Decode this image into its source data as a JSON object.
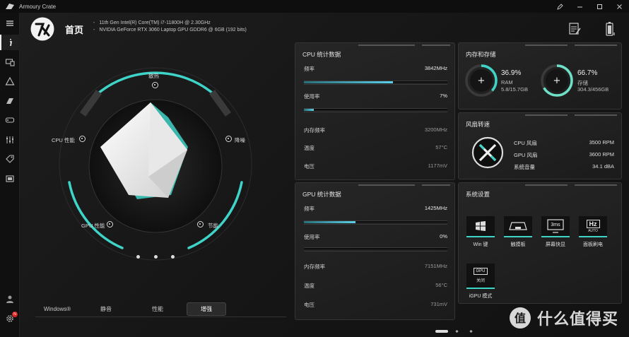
{
  "window": {
    "title": "Armoury Crate",
    "controls": [
      "minimize",
      "maximize",
      "close"
    ],
    "extra_icon": "pen-icon"
  },
  "header": {
    "title": "首页",
    "cpu_spec": "11th Gen Intel(R) Core(TM) i7-11800H @ 2.30GHz",
    "gpu_spec": "NVIDIA GeForce RTX 3060 Laptop GPU GDDR6 @ 6GB (192 bits)",
    "bullet": "-"
  },
  "sidebar": {
    "items": [
      "menu-icon",
      "home-icon",
      "device-icon",
      "aura-icon",
      "armoury-icon",
      "game-icon",
      "scenario-icon",
      "deals-icon",
      "content-icon"
    ],
    "bottom": [
      "user-icon",
      "settings-icon"
    ],
    "notification_badge": "N"
  },
  "dial": {
    "labels": {
      "top": "散热",
      "left": "CPU 性能",
      "right": "降噪",
      "bottom_left": "GPU 性能",
      "bottom_right": "节能"
    },
    "pager_count": 3
  },
  "modes": {
    "items": [
      "Windows®",
      "静音",
      "性能",
      "增强"
    ],
    "active": "增强"
  },
  "cpu_panel": {
    "title": "CPU 统计数据",
    "freq_label": "频率",
    "freq_value": "3842MHz",
    "freq_level": 0.62,
    "usage_label": "使用率",
    "usage_value": "7%",
    "usage_level": 0.07,
    "mem_freq_label": "内存频率",
    "mem_freq_value": "3200MHz",
    "temp_label": "温度",
    "temp_value": "57°C",
    "voltage_label": "电压",
    "voltage_value": "1177mV"
  },
  "gpu_panel": {
    "title": "GPU 统计数据",
    "freq_label": "频率",
    "freq_value": "1425MHz",
    "freq_level": 0.36,
    "usage_label": "使用率",
    "usage_value": "0%",
    "usage_level": 0.0,
    "mem_freq_label": "内存频率",
    "mem_freq_value": "7151MHz",
    "temp_label": "温度",
    "temp_value": "56°C",
    "voltage_label": "电压",
    "voltage_value": "731mV"
  },
  "memory_panel": {
    "title": "内存和存储",
    "ram_percent": "36.9%",
    "ram_label": "RAM",
    "ram_detail": "5.8/15.7GB",
    "ram_level": 0.369,
    "storage_percent": "66.7%",
    "storage_label": "存储",
    "storage_detail": "304.3/456GB",
    "storage_level": 0.667,
    "add_symbol": "+"
  },
  "fan_panel": {
    "title": "风扇转速",
    "rows": [
      {
        "label": "CPU 风扇",
        "value": "3500 RPM"
      },
      {
        "label": "GPU 风扇",
        "value": "3600 RPM"
      },
      {
        "label": "系统音量",
        "value": "34.1 dBA"
      }
    ]
  },
  "system_panel": {
    "title": "系统设置",
    "tiles": [
      {
        "label": "Win 键",
        "icon": "windows-key-icon"
      },
      {
        "label": "触摸板",
        "icon": "touchpad-icon"
      },
      {
        "label": "屏幕快显",
        "icon": "panel-overdrive-icon",
        "icon_text": "3ms"
      },
      {
        "label": "面板刷电",
        "icon": "refresh-rate-icon",
        "icon_text": "Hz",
        "icon_sub": "AUTO"
      },
      {
        "label": "iGPU 模式",
        "icon": "gpu-mode-icon",
        "icon_text": "GPU",
        "status": "关闭"
      }
    ]
  },
  "watermark": {
    "text": "值 什么值得买",
    "brand": "什么值得买",
    "glyph": "值"
  },
  "colors": {
    "accent": "#3fd4c8",
    "accent_blue": "#5ad0e8",
    "background": "#161616"
  }
}
